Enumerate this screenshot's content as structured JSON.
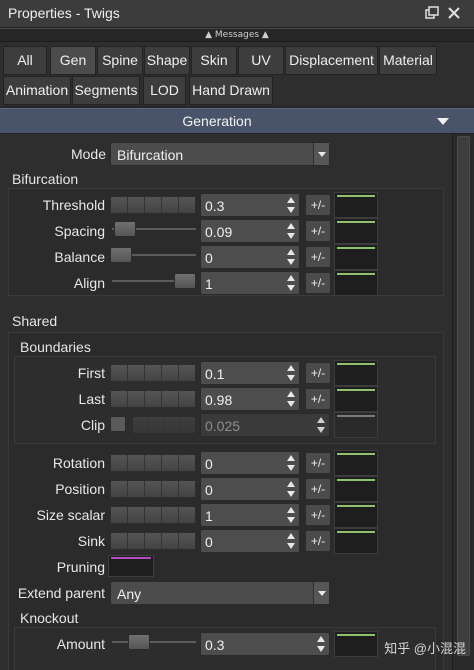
{
  "window": {
    "title": "Properties - Twigs",
    "float_icon": "float-window-icon",
    "close_icon": "close-icon"
  },
  "messages": {
    "label": "Messages"
  },
  "tabs": [
    {
      "label": "All"
    },
    {
      "label": "Gen",
      "active": true
    },
    {
      "label": "Spine"
    },
    {
      "label": "Shape"
    },
    {
      "label": "Skin"
    },
    {
      "label": "UV"
    },
    {
      "label": "Displacement"
    },
    {
      "label": "Material"
    },
    {
      "label": "Animation"
    },
    {
      "label": "Segments"
    },
    {
      "label": "LOD"
    },
    {
      "label": "Hand Drawn"
    }
  ],
  "section": {
    "title": "Generation"
  },
  "mode": {
    "label": "Mode",
    "value": "Bifurcation"
  },
  "bifurcation": {
    "title": "Bifurcation",
    "rows": [
      {
        "label": "Threshold",
        "value": "0.3",
        "control": "ladder"
      },
      {
        "label": "Spacing",
        "value": "0.09",
        "control": "slider",
        "slider_fraction": 0.09
      },
      {
        "label": "Balance",
        "value": "0",
        "control": "slider",
        "slider_fraction": 0
      },
      {
        "label": "Align",
        "value": "1",
        "control": "slider",
        "slider_fraction": 1
      }
    ]
  },
  "shared": {
    "title": "Shared",
    "boundaries": {
      "title": "Boundaries",
      "rows": [
        {
          "label": "First",
          "value": "0.1"
        },
        {
          "label": "Last",
          "value": "0.98"
        },
        {
          "label": "Clip",
          "value": "0.025",
          "disabled": true
        }
      ]
    },
    "rows": [
      {
        "label": "Rotation",
        "value": "0"
      },
      {
        "label": "Position",
        "value": "0"
      },
      {
        "label": "Size scalar",
        "value": "1"
      },
      {
        "label": "Sink",
        "value": "0"
      }
    ],
    "pruning": {
      "label": "Pruning"
    },
    "extend_parent": {
      "label": "Extend parent",
      "value": "Any"
    },
    "knockout": {
      "title": "Knockout",
      "amount": {
        "label": "Amount",
        "value": "0.3",
        "slider_fraction": 0.3
      }
    }
  },
  "common": {
    "plus_minus": "+/-"
  },
  "watermark": {
    "text": "知乎 @小混混"
  },
  "colors": {
    "curve": "#8fc26c",
    "pruning_swatch": "#b14fbf",
    "header": "#49546a"
  }
}
